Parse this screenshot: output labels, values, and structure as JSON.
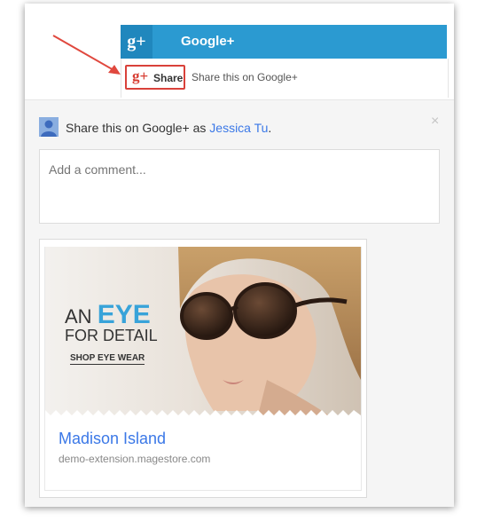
{
  "header": {
    "logo_glyph": "g+",
    "title": "Google+",
    "bar_color": "#2b9ad1"
  },
  "share_widget": {
    "button_label": "Share",
    "button_logo": "g+",
    "caption": "Share this on Google+",
    "highlight_color": "#d9413a"
  },
  "share_dialog": {
    "prefix": "Share this on Google+ as",
    "user_name": "Jessica Tu",
    "suffix": ".",
    "close_glyph": "×",
    "comment_placeholder": "Add a comment..."
  },
  "preview_card": {
    "ad_line1_word": "AN",
    "ad_line1_highlight": "EYE",
    "ad_line2": "FOR DETAIL",
    "ad_cta": "SHOP EYE WEAR",
    "title": "Madison Island",
    "url": "demo-extension.magestore.com"
  }
}
